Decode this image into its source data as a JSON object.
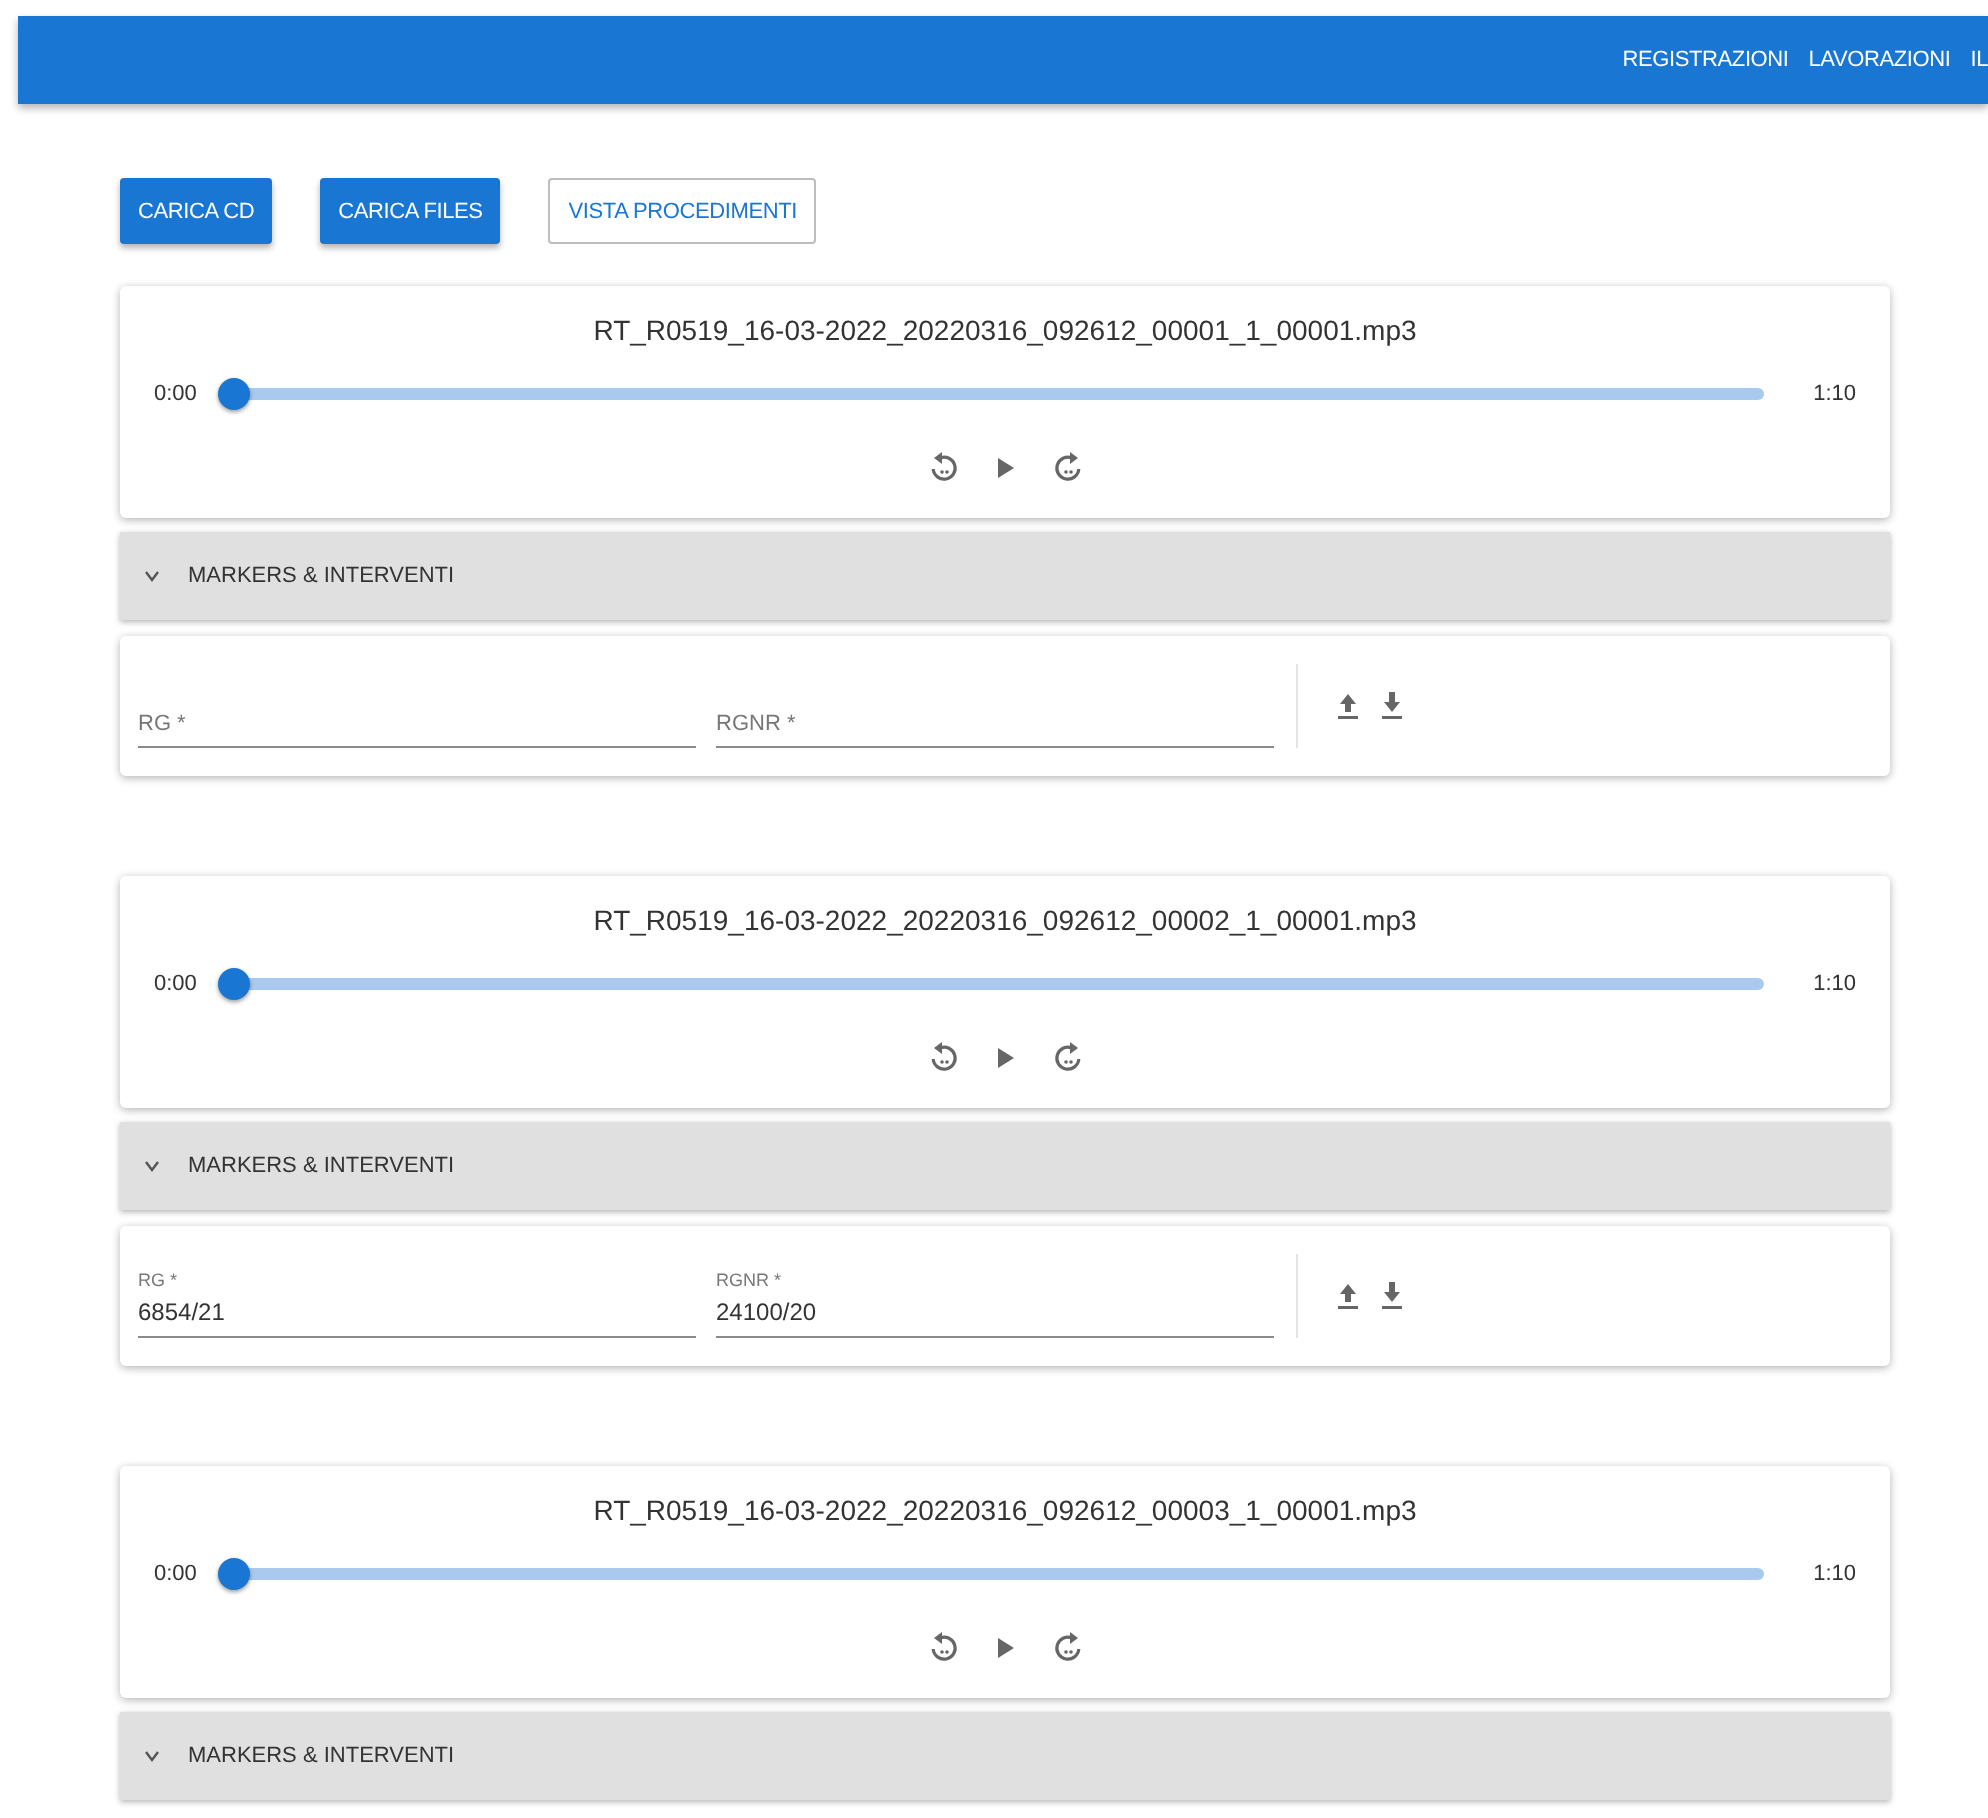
{
  "app_bar": {
    "nav": [
      "REGISTRAZIONI",
      "LAVORAZIONI",
      "IL"
    ]
  },
  "actions": [
    {
      "label": "CARICA CD",
      "kind": "filled"
    },
    {
      "label": "CARICA FILES",
      "kind": "filled"
    },
    {
      "label": "VISTA PROCEDIMENTI",
      "kind": "outlined"
    }
  ],
  "recordings": [
    {
      "file": "RT_R0519_16-03-2022_20220316_092612_00001_1_00001.mp3",
      "current": "0:00",
      "duration": "1:10",
      "level": 0,
      "panel": {
        "label": "MARKERS & INTERVENTI",
        "expanded": false
      },
      "fields": [
        {
          "placeholder": "RG *"
        },
        {
          "placeholder": "RGNR *"
        }
      ]
    },
    {
      "file": "RT_R0519_16-03-2022_20220316_092612_00002_1_00001.mp3",
      "current": "0:00",
      "duration": "1:10",
      "level": 0,
      "panel": {
        "label": "MARKERS & INTERVENTI",
        "expanded": false
      },
      "fields": [
        {
          "label": "RG *",
          "value": "6854/21"
        },
        {
          "label": "RGNR *",
          "value": "24100/20"
        }
      ]
    },
    {
      "file": "RT_R0519_16-03-2022_20220316_092612_00003_1_00001.mp3",
      "current": "0:00",
      "duration": "1:10",
      "level": 0,
      "panel": {
        "label": "MARKERS & INTERVENTI",
        "expanded": false
      }
    }
  ]
}
